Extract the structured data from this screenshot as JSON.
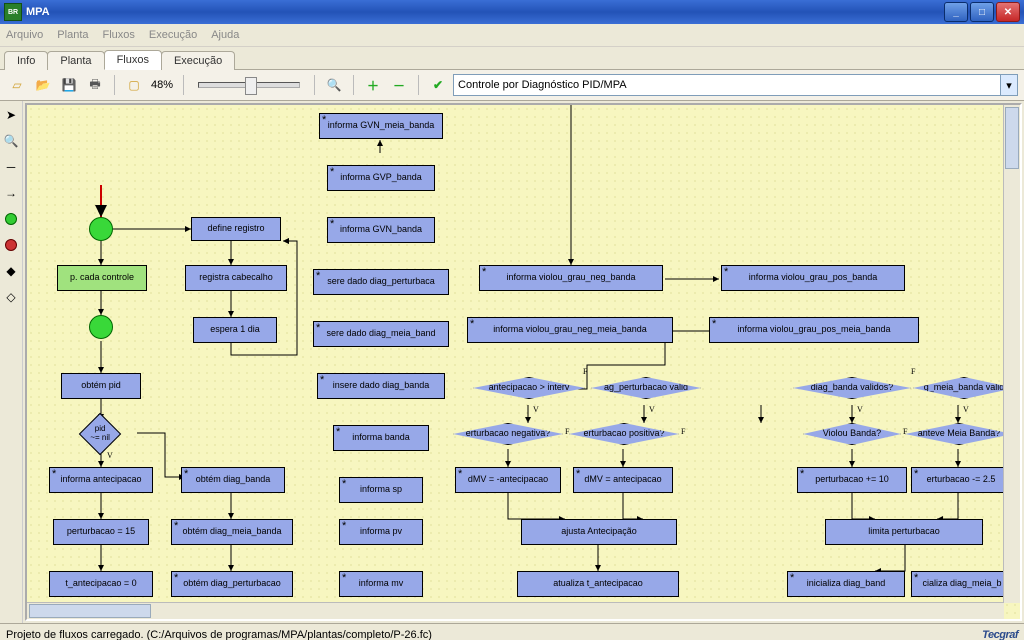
{
  "window": {
    "app_abbr": "BR",
    "title": "MPA"
  },
  "menu": {
    "items": [
      "Arquivo",
      "Planta",
      "Fluxos",
      "Execução",
      "Ajuda"
    ]
  },
  "tabs": {
    "items": [
      "Info",
      "Planta",
      "Fluxos",
      "Execução"
    ],
    "active_index": 2
  },
  "toolbar": {
    "new": "new",
    "open": "open",
    "save": "save",
    "print": "print",
    "preview": "preview",
    "zoom_pct": "48%",
    "zoom_out": "zoom-out",
    "zoom_reset": "zoom-reset",
    "plus": "+",
    "minus": "−",
    "check": "✓",
    "combo_value": "Controle por Diagnóstico PID/MPA"
  },
  "sidetools": {
    "cursor": "cursor",
    "zoom": "zoom",
    "line": "line",
    "rarrow": "right-arrow",
    "green": "green-node",
    "red": "red-node",
    "polyshape": "polyshape",
    "diamond_tool": "diamond"
  },
  "diagram": {
    "p_cada_controle": "p. cada controle",
    "define_registro": "define registro",
    "registra_cabecalho": "registra cabecalho",
    "espera_1_dia": "espera 1 dia",
    "obtem_pid": "obtém pid",
    "pid_ne_nil": "pid ~= nil",
    "informa_antecipacao": "informa antecipacao",
    "perturbacao_15": "perturbacao = 15",
    "t_antecipacao_0": "t_antecipacao = 0",
    "obtem_diag_banda": "obtém diag_banda",
    "obtem_diag_meia_banda": "obtém diag_meia_banda",
    "obtem_diag_perturbacao": "obtém diag_perturbacao",
    "informa_gvn_meia_banda": "informa GVN_meia_banda",
    "informa_gvp_banda": "informa GVP_banda",
    "informa_gvn_banda": "informa GVN_banda",
    "sere_dado_diag_perturbaca": "sere dado diag_perturbaca",
    "sere_dado_diag_meia_band": "sere dado diag_meia_band",
    "insere_dado_diag_banda": "insere dado diag_banda",
    "informa_banda": "informa banda",
    "informa_sp": "informa sp",
    "informa_pv": "informa pv",
    "informa_mv": "informa mv",
    "informa_violou_grau_neg_banda": "informa violou_grau_neg_banda",
    "informa_violou_grau_pos_banda": "informa violou_grau_pos_banda",
    "informa_violou_grau_neg_meia_banda": "informa violou_grau_neg_meia_banda",
    "informa_violou_grau_pos_meia_banda": "informa violou_grau_pos_meia_banda",
    "antecipacao_gt_interv": "antecipacao > interv",
    "ag_perturbacao_valid": "ag_perturbacao valid",
    "diag_banda_validos": "diag_banda validos?",
    "g_meia_banda_valid": "g_meia_banda valid",
    "perturbacao_negativa": "erturbacao negativa?",
    "perturbacao_positiva": "erturbacao positiva?",
    "violou_banda": "Violou Banda?",
    "manteve_meia_banda": "anteve Meia Banda?",
    "dmv_neg": "dMV = -antecipacao",
    "dmv_pos": "dMV = antecipacao",
    "pert_plus10": "perturbacao += 10",
    "pert_minus25": "erturbacao -= 2.5",
    "ajusta_antecipacao": "ajusta Antecipação",
    "limita_perturbacao": "limita perturbacao",
    "atualiza_t_antecipacao": "atualiza t_antecipacao",
    "inicializa_diag_band": "inicializa diag_band",
    "cializa_diag_meia_b": "cializa diag_meia_b",
    "V": "V",
    "F": "F"
  },
  "statusbar": {
    "text": "Projeto de fluxos carregado. (C:/Arquivos de programas/MPA/plantas/completo/P-26.fc)",
    "logo": "Tecgraf"
  }
}
